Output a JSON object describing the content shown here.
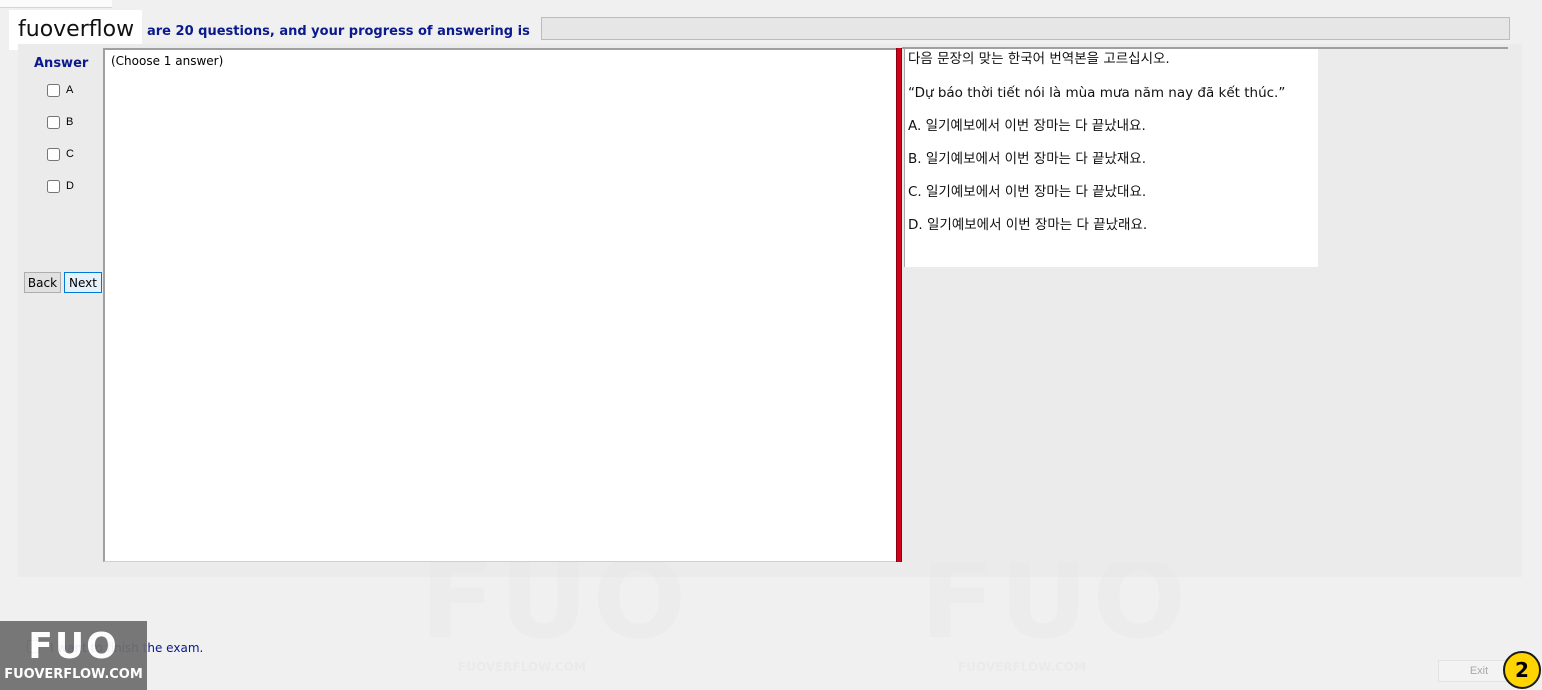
{
  "brand": "fuoverflow",
  "header": {
    "progress_text": "are 20 questions, and your progress of answering is",
    "progress_value": 0
  },
  "answer_panel": {
    "header": "Answer",
    "options": [
      {
        "label": "A",
        "checked": false
      },
      {
        "label": "B",
        "checked": false
      },
      {
        "label": "C",
        "checked": false
      },
      {
        "label": "D",
        "checked": false
      }
    ],
    "back_label": "Back",
    "next_label": "Next",
    "choose_note": "(Choose 1 answer)"
  },
  "question": {
    "prompt": "다음 문장의 맞는 한국어 번역본을 고르십시오.",
    "sentence": "“Dự báo thời tiết nói là mùa mưa năm nay đã kết thúc.”",
    "choices": [
      "A.  일기예보에서 이번 장마는 다 끝났내요.",
      "B.  일기예보에서 이번 장마는 다 끝났재요.",
      "C.  일기예보에서 이번 장마는 다 끝났대요.",
      "D.  일기예보에서 이번 장마는 다 끝났래요."
    ]
  },
  "footer": {
    "finish_label": "I want to finish the exam.",
    "exit_label": "Exit",
    "step_number": "2",
    "badge_logo": "FUO",
    "badge_site": "FUOVERFLOW.COM"
  },
  "watermark": {
    "logo": "FUO",
    "site": "FUOVERFLOW.COM"
  },
  "colors": {
    "accent_text": "#0a1a8c",
    "splitter": "#d0021b",
    "step_badge": "#ffd400"
  }
}
